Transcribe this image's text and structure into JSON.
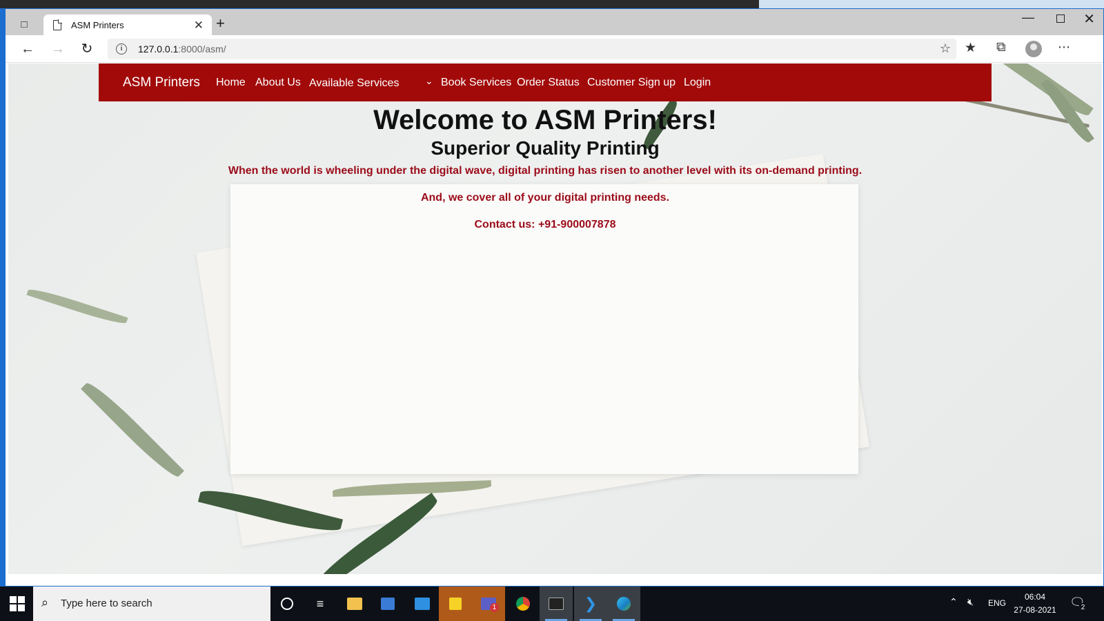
{
  "browser": {
    "tab_title": "ASM Printers",
    "url_host": "127.0.0.1",
    "url_rest": ":8000/asm/"
  },
  "navbar": {
    "brand": "ASM Printers",
    "items": [
      {
        "label": "Home"
      },
      {
        "label": "About Us"
      },
      {
        "label": "Available Services"
      },
      {
        "label": "Book Services"
      },
      {
        "label": "Order Status"
      },
      {
        "label": "Customer Sign up"
      },
      {
        "label": "Login"
      }
    ]
  },
  "hero": {
    "title": "Welcome to ASM Printers!",
    "subtitle": "Superior Quality Printing",
    "messages": [
      "When the world is wheeling under the digital wave, digital printing has risen to another level with its on-demand printing.",
      "And, we cover all of your digital printing needs.",
      "Contact us: +91-900007878"
    ]
  },
  "taskbar": {
    "search_placeholder": "Type here to search",
    "teams_badge": "1",
    "language": "ENG",
    "time": "06:04",
    "date": "27-08-2021",
    "notification_count": "2"
  },
  "colors": {
    "navbar": "#a20a0a",
    "message_text": "#9b0b19",
    "window_accent": "#1c6dd0"
  },
  "icons": [
    "tab-actions-icon",
    "page-icon",
    "close-icon",
    "plus-icon",
    "back-arrow-icon",
    "forward-arrow-icon",
    "reload-icon",
    "info-icon",
    "favorite-add-icon",
    "favorites-icon",
    "collections-icon",
    "profile-icon",
    "more-icon",
    "chevron-down-icon",
    "windows-start-icon",
    "search-icon",
    "cortana-icon",
    "task-view-icon",
    "file-explorer-icon",
    "store-icon",
    "mail-icon",
    "sticky-notes-icon",
    "teams-icon",
    "chrome-icon",
    "terminal-icon",
    "vscode-icon",
    "edge-icon",
    "chevron-up-icon",
    "volume-muted-icon",
    "notification-icon"
  ]
}
